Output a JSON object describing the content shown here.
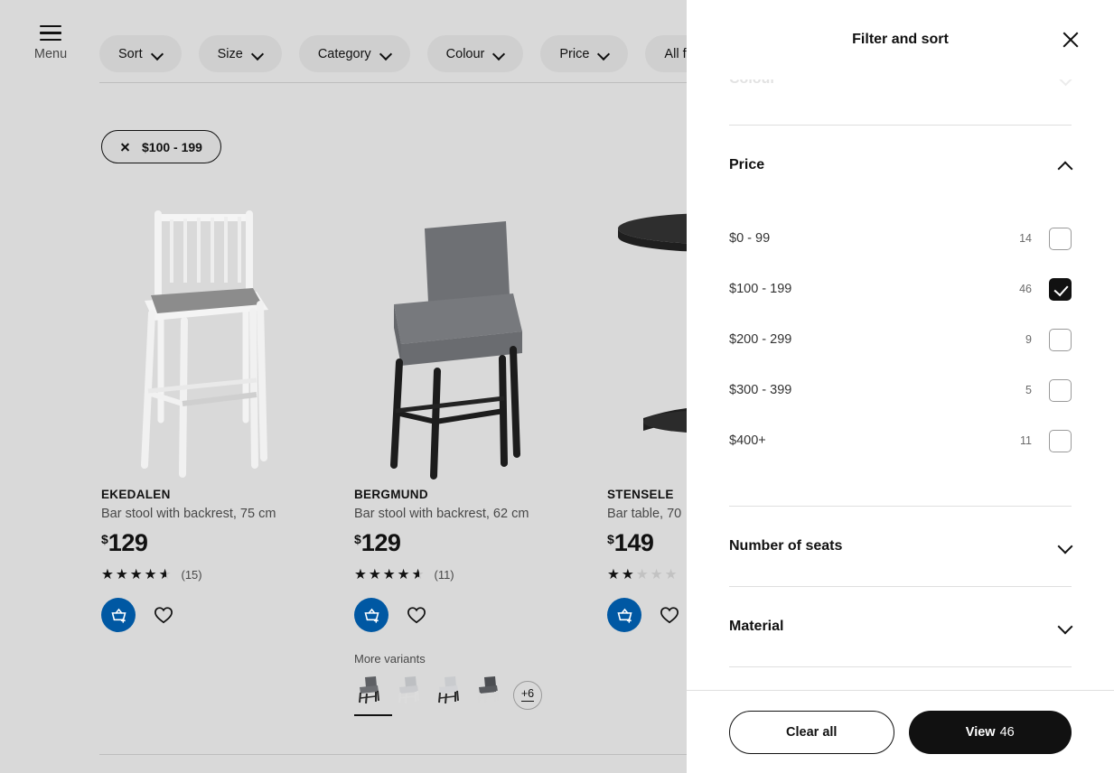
{
  "toolbar": {
    "menu_label": "Menu",
    "menu_icon": "hamburger-icon",
    "pills": [
      {
        "label": "Sort",
        "icon": "chevron-down-icon"
      },
      {
        "label": "Size",
        "icon": "chevron-down-icon"
      },
      {
        "label": "Category",
        "icon": "chevron-down-icon"
      },
      {
        "label": "Colour",
        "icon": "chevron-down-icon"
      },
      {
        "label": "Price",
        "icon": "chevron-down-icon"
      },
      {
        "label": "All filters",
        "icon": "chevron-down-icon"
      }
    ]
  },
  "active_filters": [
    {
      "label": "$100 - 199",
      "remove_icon": "close-icon"
    }
  ],
  "products": [
    {
      "name": "EKEDALEN",
      "description": "Bar stool with backrest, 75 cm",
      "currency": "$",
      "price": "129",
      "rating": 4.5,
      "review_count": "(15)",
      "cart_icon": "add-to-cart-basket-icon",
      "wishlist_icon": "heart-icon"
    },
    {
      "name": "BERGMUND",
      "description": "Bar stool with backrest, 62 cm",
      "currency": "$",
      "price": "129",
      "rating": 4.5,
      "review_count": "(11)",
      "cart_icon": "add-to-cart-basket-icon",
      "wishlist_icon": "heart-icon",
      "variants": {
        "label": "More variants",
        "more_label": "+6",
        "swatches": [
          "dark-grey-stool",
          "light-grey-stool",
          "white-grey-stool",
          "charcoal-stool"
        ]
      }
    },
    {
      "name": "STENSELE",
      "description": "Bar table, 70",
      "currency": "$",
      "price": "149",
      "rating": 2,
      "review_count": "(",
      "cart_icon": "add-to-cart-basket-icon",
      "wishlist_icon": "heart-icon"
    }
  ],
  "panel": {
    "title": "Filter and sort",
    "close_icon": "close-icon",
    "scrolled_section": {
      "title": "Colour",
      "icon": "chevron-down-icon"
    },
    "price_section": {
      "title": "Price",
      "icon": "chevron-up-icon",
      "options": [
        {
          "label": "$0 - 99",
          "count": "14",
          "checked": false
        },
        {
          "label": "$100 - 199",
          "count": "46",
          "checked": true
        },
        {
          "label": "$200 - 299",
          "count": "9",
          "checked": false
        },
        {
          "label": "$300 - 399",
          "count": "5",
          "checked": false
        },
        {
          "label": "$400+",
          "count": "11",
          "checked": false
        }
      ]
    },
    "collapsed_sections": [
      {
        "title": "Number of seats",
        "icon": "chevron-down-icon"
      },
      {
        "title": "Material",
        "icon": "chevron-down-icon"
      }
    ],
    "footer": {
      "clear_label": "Clear all",
      "view_label": "View",
      "view_count": "46"
    }
  },
  "colors": {
    "brand_blue": "#0058a3",
    "page_dim": "#d9d9d9",
    "panel_bg": "#ffffff",
    "accent_dark": "#111111"
  }
}
